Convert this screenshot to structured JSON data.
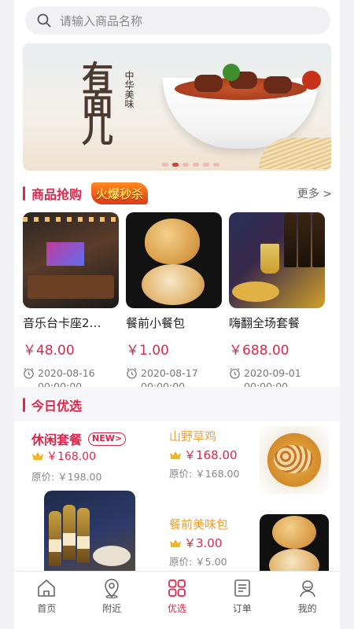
{
  "search": {
    "placeholder": "请输入商品名称"
  },
  "banner": {
    "title": "有面儿",
    "subtitle": "中华美味",
    "slide_count": 6,
    "active_slide": 1
  },
  "flash": {
    "title": "商品抢购",
    "tag": "火爆秒杀",
    "more": "更多 >",
    "items": [
      {
        "name": "音乐台卡座2…",
        "price": "￥48.00",
        "date": "2020-08-16",
        "time": "00:00:00"
      },
      {
        "name": "餐前小餐包",
        "price": "￥1.00",
        "date": "2020-08-17",
        "time": "00:00:00"
      },
      {
        "name": "嗨翻全场套餐",
        "price": "￥688.00",
        "date": "2020-09-01",
        "time": "00:00:00"
      }
    ]
  },
  "today": {
    "title": "今日优选",
    "featured": {
      "name": "休闲套餐",
      "badge": "NEW>",
      "vip_price": "￥168.00",
      "original_price": "原价: ￥198.00"
    },
    "items": [
      {
        "name": "山野草鸡",
        "vip_price": "￥168.00",
        "original_price": "原价: ￥168.00"
      },
      {
        "name": "餐前美味包",
        "vip_price": "￥3.00",
        "original_price": "原价: ￥5.00"
      }
    ]
  },
  "tabs": [
    {
      "label": "首页",
      "icon": "home-icon"
    },
    {
      "label": "附近",
      "icon": "location-icon"
    },
    {
      "label": "优选",
      "icon": "grid-icon",
      "active": true
    },
    {
      "label": "订单",
      "icon": "order-icon"
    },
    {
      "label": "我的",
      "icon": "profile-icon"
    }
  ],
  "colors": {
    "accent": "#e0244a",
    "gold": "#e8a43a",
    "inactive": "#555555"
  }
}
